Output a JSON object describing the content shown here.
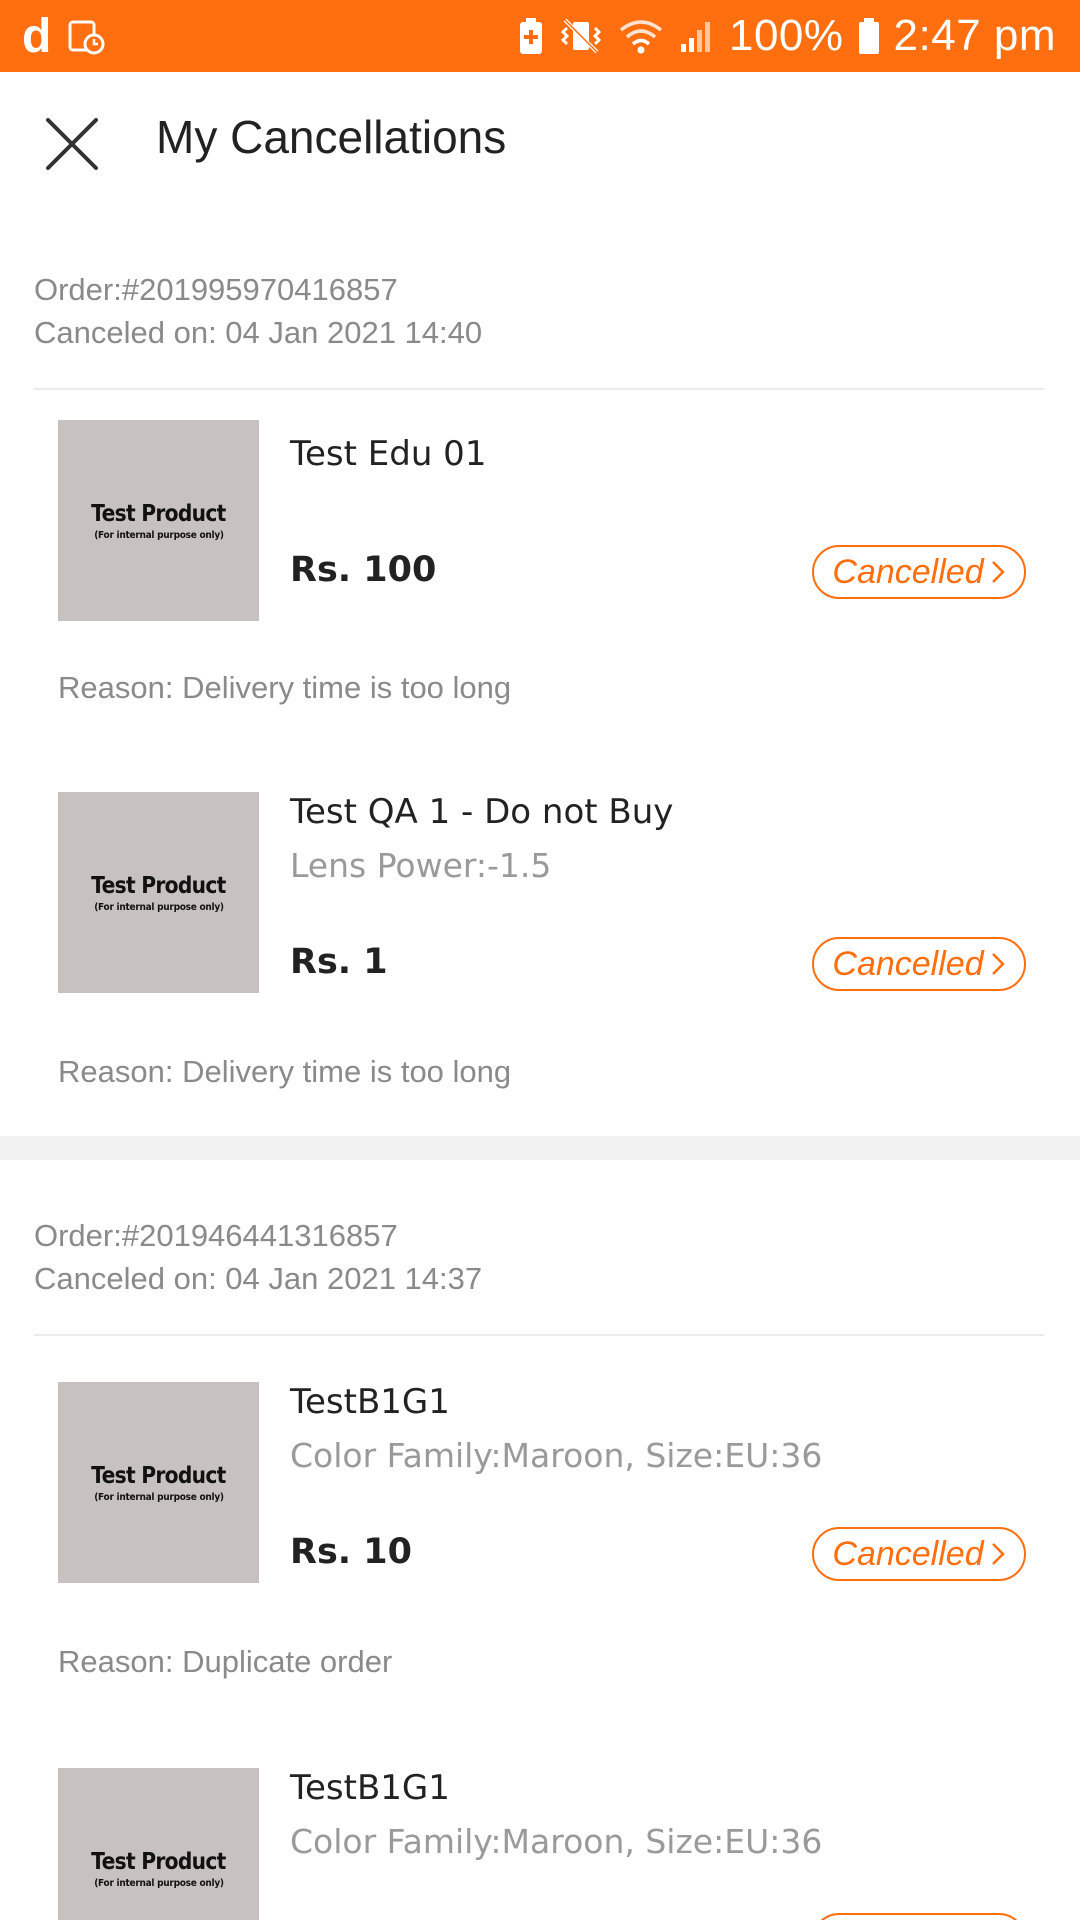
{
  "status_bar": {
    "app_glyph": "d",
    "battery_percent": "100%",
    "time": "2:47 pm",
    "background": "#ff6e0f",
    "icons": [
      "app-logo-icon",
      "screenshot-icon",
      "battery-saver-icon",
      "vibrate-off-icon",
      "wifi-icon",
      "signal-icon",
      "battery-icon"
    ]
  },
  "header": {
    "title": "My Cancellations",
    "close_icon": "close-icon"
  },
  "accent_color": "#ff6e0f",
  "placeholder_image": {
    "title": "Test Product",
    "subtitle": "(For internal purpose only)"
  },
  "orders": [
    {
      "order_number": "Order:#201995970416857",
      "canceled_on": "Canceled on: 04 Jan 2021 14:40",
      "items": [
        {
          "name": "Test Edu 01",
          "variant": "",
          "price": "Rs. 100",
          "status": "Cancelled",
          "reason": "Reason: Delivery time is too long"
        },
        {
          "name": "Test QA 1 - Do not Buy",
          "variant": "Lens Power:-1.5",
          "price": "Rs. 1",
          "status": "Cancelled",
          "reason": "Reason: Delivery time is too long"
        }
      ]
    },
    {
      "order_number": "Order:#201946441316857",
      "canceled_on": "Canceled on: 04 Jan 2021 14:37",
      "items": [
        {
          "name": "TestB1G1",
          "variant": "Color Family:Maroon, Size:EU:36",
          "price": "Rs. 10",
          "status": "Cancelled",
          "reason": "Reason: Duplicate order"
        },
        {
          "name": "TestB1G1",
          "variant": "Color Family:Maroon, Size:EU:36",
          "price": "",
          "status": "",
          "reason": ""
        }
      ]
    }
  ]
}
